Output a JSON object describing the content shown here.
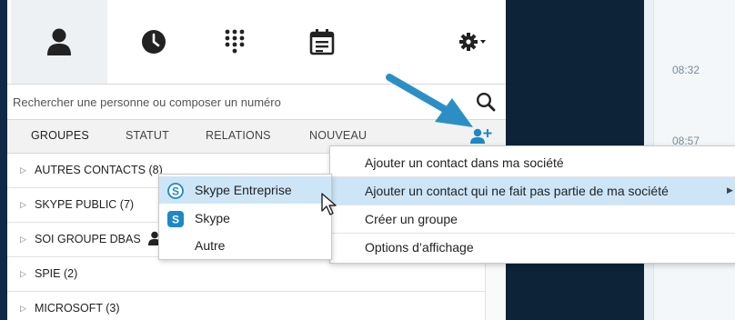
{
  "toolbar": {
    "contacts_icon": "person-icon",
    "recent_icon": "clock-icon",
    "dialpad_icon": "dialpad-icon",
    "meetings_icon": "calendar-icon",
    "settings_icon": "gear-icon"
  },
  "search": {
    "placeholder": "Rechercher une personne ou composer un numéro",
    "icon": "search-icon"
  },
  "tabs": {
    "groups": "GROUPES",
    "status": "STATUT",
    "relations": "RELATIONS",
    "new": "NOUVEAU",
    "add_contact_icon": "add-contact-icon"
  },
  "groups": [
    {
      "label": "AUTRES CONTACTS (8)"
    },
    {
      "label": "SKYPE PUBLIC (7)"
    },
    {
      "label": "SOI GROUPE DBAS"
    },
    {
      "label": "SPIE (2)"
    },
    {
      "label": "MICROSOFT (3)"
    }
  ],
  "submenu": {
    "items": [
      {
        "label": "Skype Entreprise",
        "icon": "skype-business-icon"
      },
      {
        "label": "Skype",
        "icon": "skype-icon"
      },
      {
        "label": "Autre"
      }
    ]
  },
  "context_menu": {
    "items": [
      {
        "label": "Ajouter un contact dans ma société"
      },
      {
        "label": "Ajouter un contact qui ne fait pas partie de ma société"
      },
      {
        "label": "Créer un groupe"
      },
      {
        "label": "Options d’affichage"
      }
    ]
  },
  "conversation": {
    "times": [
      "08:32",
      "08:57"
    ]
  },
  "colors": {
    "accent": "#1e88c7",
    "arrow": "#2b8fc5",
    "highlight": "#cde6f7",
    "dark_panel": "#0d2338"
  }
}
